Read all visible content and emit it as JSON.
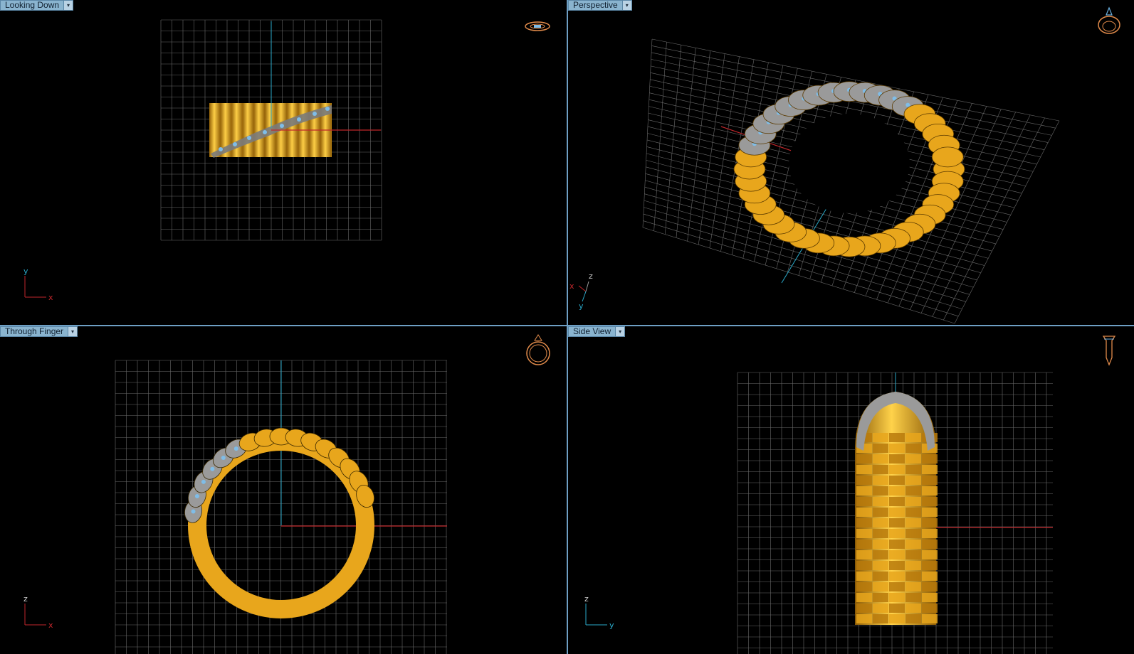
{
  "viewports": {
    "looking_down": {
      "label": "Looking Down",
      "dropdown": "▾",
      "axes": {
        "horizontal": "x",
        "vertical": "y"
      }
    },
    "perspective": {
      "label": "Perspective",
      "dropdown": "▾",
      "axes": {
        "a": "x",
        "b": "y",
        "c": "z"
      }
    },
    "through_finger": {
      "label": "Through Finger",
      "dropdown": "▾",
      "axes": {
        "horizontal": "x",
        "vertical": "z"
      }
    },
    "side_view": {
      "label": "Side View",
      "dropdown": "▾",
      "axes": {
        "horizontal": "y",
        "vertical": "z"
      }
    }
  },
  "colors": {
    "background": "#000000",
    "grid": "#6a6a6a",
    "x_axis": "#c0262b",
    "y_axis": "#2aa8c8",
    "gold": "#e8a61c",
    "gold_dark": "#8a5a06",
    "metal": "#9a9a9a",
    "gem": "#7fbde8",
    "view_cube": "#e08a4a",
    "divider": "#6e9fc4"
  },
  "icons": {
    "looking_down": "ring-top-view-icon",
    "perspective": "ring-perspective-icon",
    "through_finger": "ring-front-view-icon",
    "side_view": "ring-side-view-icon"
  }
}
